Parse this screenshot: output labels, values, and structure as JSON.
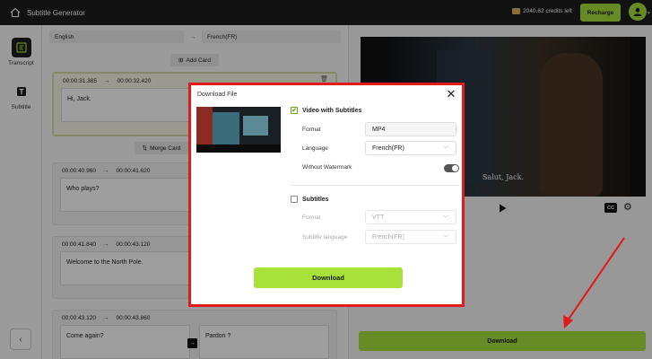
{
  "app": {
    "title": "Subtitle Generator",
    "credits": "2040.62 credits left",
    "recharge_label": "Recharge"
  },
  "nav": {
    "items": [
      {
        "label": "Transcript",
        "icon": "transcript-icon"
      },
      {
        "label": "Subtitle",
        "icon": "subtitle-icon"
      }
    ]
  },
  "editor": {
    "source_language": "English",
    "target_language": "French(FR)",
    "add_card_label": "Add Card",
    "merge_card_label": "Merge Card",
    "cards": [
      {
        "start": "00:00:31.385",
        "end": "00:00:32.420",
        "text": "Hi, Jack."
      },
      {
        "start": "00:00:40.960",
        "end": "00:00:41.620",
        "text": "Who plays?"
      },
      {
        "start": "00:00:41.840",
        "end": "00:00:43.120",
        "text": "Welcome to the North Pole."
      },
      {
        "start": "00:00:43.120",
        "end": "00:00:43.860",
        "text": "Come again?",
        "translation": "Pardon ?"
      }
    ],
    "time_separator": "→"
  },
  "preview": {
    "subtitle_text": "Salut, Jack.",
    "cc_label": "CC",
    "download_label": "Download"
  },
  "modal": {
    "title": "Download File",
    "video_option": {
      "label": "Video with Subtitles",
      "checked": true
    },
    "format_label": "Format",
    "format_value": "MP4",
    "language_label": "Language",
    "language_value": "French(FR)",
    "watermark_label": "Without Watermark",
    "watermark_on": true,
    "subtitles_option": {
      "label": "Subtitles",
      "checked": false
    },
    "subtitle_format_label": "Format",
    "subtitle_format_value": "VTT",
    "subtitle_language_label": "Subtitle language",
    "subtitle_language_value": "French(FR)",
    "download_label": "Download"
  },
  "colors": {
    "accent": "#a7e13a",
    "highlight_border": "#e01b1b",
    "annotation_arrow": "#e01b1b"
  }
}
